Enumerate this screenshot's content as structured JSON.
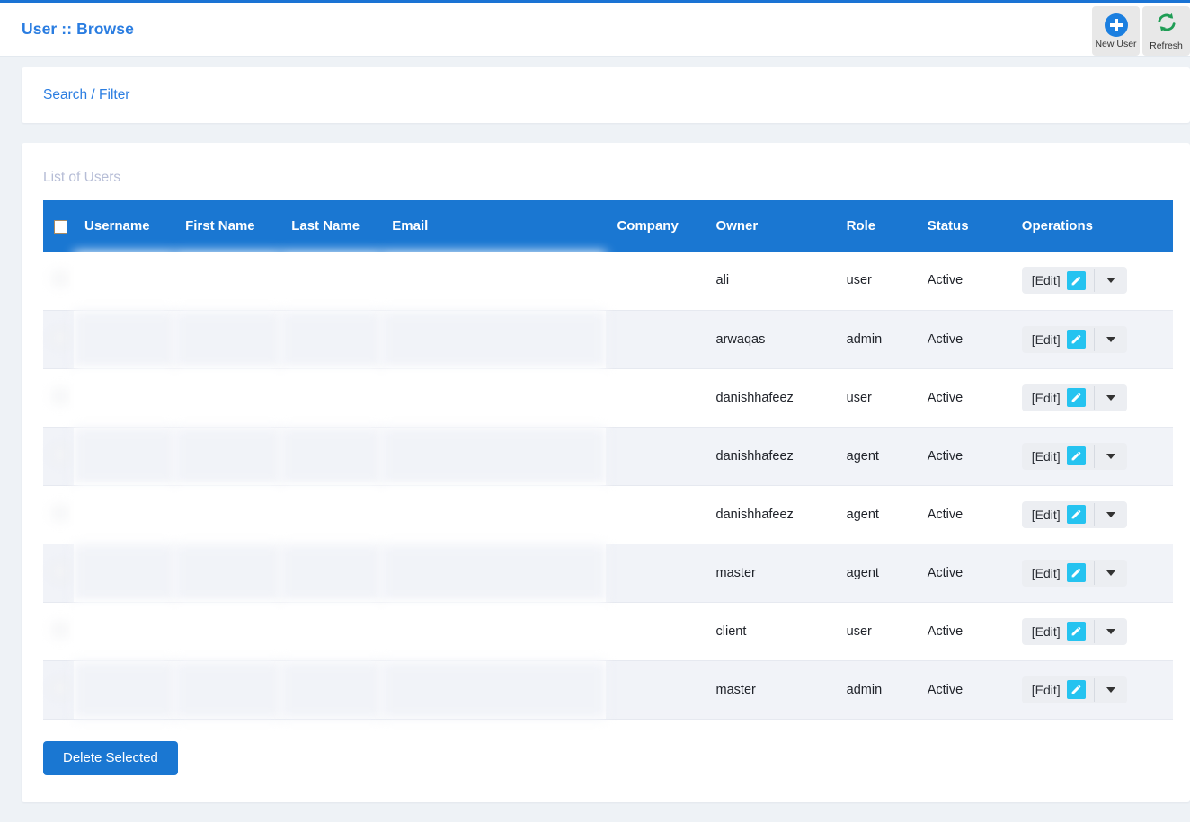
{
  "header": {
    "title": "User :: Browse",
    "accent_color": "#2a7de1",
    "actions": [
      {
        "label": "New User",
        "icon": "plus-circle-icon"
      },
      {
        "label": "Refresh",
        "icon": "refresh-icon"
      }
    ]
  },
  "search_panel": {
    "link_label": "Search / Filter"
  },
  "list_panel": {
    "title": "List of Users",
    "table": {
      "header_bg": "#1a77d2",
      "columns": [
        "",
        "Username",
        "First Name",
        "Last Name",
        "Email",
        "Company",
        "Owner",
        "Role",
        "Status",
        "Operations"
      ],
      "rows": [
        {
          "username": "",
          "first_name": "",
          "last_name": "",
          "email": "",
          "company": "",
          "owner": "ali",
          "role": "user",
          "status": "Active",
          "edit_label": "[Edit]"
        },
        {
          "username": "",
          "first_name": "",
          "last_name": "",
          "email": "",
          "company": "",
          "owner": "arwaqas",
          "role": "admin",
          "status": "Active",
          "edit_label": "[Edit]"
        },
        {
          "username": "",
          "first_name": "",
          "last_name": "",
          "email": "",
          "company": "",
          "owner": "danishhafeez",
          "role": "user",
          "status": "Active",
          "edit_label": "[Edit]"
        },
        {
          "username": "",
          "first_name": "",
          "last_name": "",
          "email": "",
          "company": "",
          "owner": "danishhafeez",
          "role": "agent",
          "status": "Active",
          "edit_label": "[Edit]"
        },
        {
          "username": "",
          "first_name": "",
          "last_name": "",
          "email": "",
          "company": "",
          "owner": "danishhafeez",
          "role": "agent",
          "status": "Active",
          "edit_label": "[Edit]"
        },
        {
          "username": "",
          "first_name": "",
          "last_name": "",
          "email": "",
          "company": "",
          "owner": "master",
          "role": "agent",
          "status": "Active",
          "edit_label": "[Edit]"
        },
        {
          "username": "",
          "first_name": "",
          "last_name": "",
          "email": "",
          "company": "",
          "owner": "client",
          "role": "user",
          "status": "Active",
          "edit_label": "[Edit]"
        },
        {
          "username": "",
          "first_name": "",
          "last_name": "",
          "email": "",
          "company": "",
          "owner": "master",
          "role": "admin",
          "status": "Active",
          "edit_label": "[Edit]"
        }
      ]
    },
    "delete_label": "Delete Selected"
  }
}
